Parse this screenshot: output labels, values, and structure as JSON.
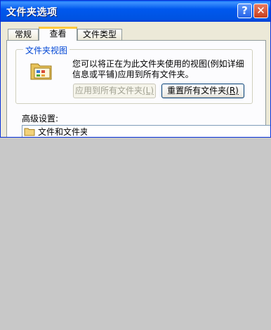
{
  "window": {
    "title": "文件夹选项",
    "help_symbol": "?",
    "close_symbol": "✕"
  },
  "tabs": [
    {
      "label": "常规",
      "active": false
    },
    {
      "label": "查看",
      "active": true
    },
    {
      "label": "文件类型",
      "active": false
    }
  ],
  "folder_views": {
    "group_title": "文件夹视图",
    "icon": "folder-view-icon",
    "description": "您可以将正在为此文件夹使用的视图(例如详细信息或平铺)应用到所有文件夹。",
    "apply_button": {
      "label": "应用到所有文件夹",
      "accel": "(L)",
      "enabled": false
    },
    "reset_button": {
      "label": "重置所有文件夹",
      "accel": "(R)",
      "enabled": true
    }
  },
  "advanced": {
    "label": "高级设置:",
    "tree_items": [
      {
        "label": "文件和文件夹",
        "icon": "folder-icon"
      }
    ]
  },
  "colors": {
    "title_bar": "#0058ee",
    "dialog_bg": "#ece9d8",
    "group_title": "#0046d5",
    "background": "#c8c8c8"
  }
}
